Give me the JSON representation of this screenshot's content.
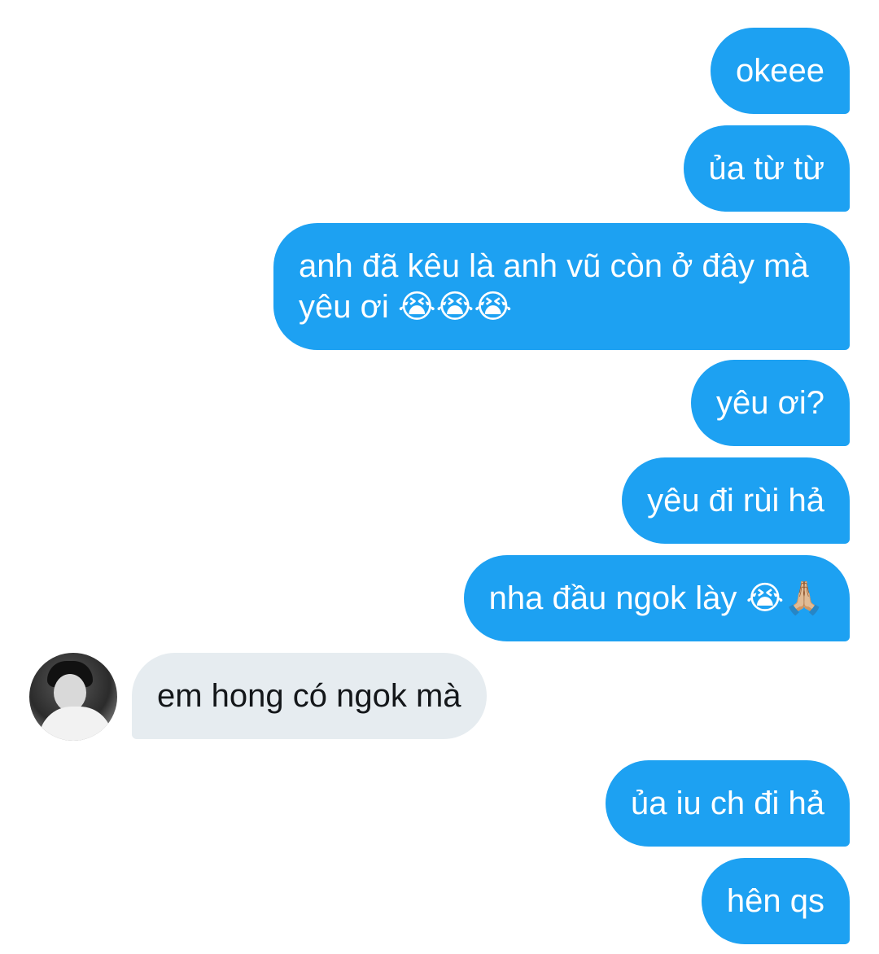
{
  "conversation": {
    "messages": [
      {
        "direction": "out",
        "text": "okeee"
      },
      {
        "direction": "out",
        "text": "ủa từ từ"
      },
      {
        "direction": "out",
        "line1": "anh đã kêu là anh vũ còn ở đây mà",
        "line2": "yêu ơi",
        "emoji": "😭😭😭"
      },
      {
        "direction": "out",
        "text": "yêu ơi?"
      },
      {
        "direction": "out",
        "text": "yêu đi rùi hả"
      },
      {
        "direction": "out",
        "text": "nha đầu ngok lày",
        "emoji": "😭🙏🏼"
      },
      {
        "direction": "in",
        "text": "em hong có ngok mà"
      },
      {
        "direction": "out",
        "text": "ủa iu ch đi hả"
      },
      {
        "direction": "out",
        "text": "hên qs"
      }
    ]
  },
  "colors": {
    "outgoing_bubble": "#1da1f2",
    "incoming_bubble": "#e6ecf0",
    "outgoing_text": "#ffffff",
    "incoming_text": "#14171a"
  },
  "icons": {
    "avatar": "contact-avatar-photo"
  }
}
